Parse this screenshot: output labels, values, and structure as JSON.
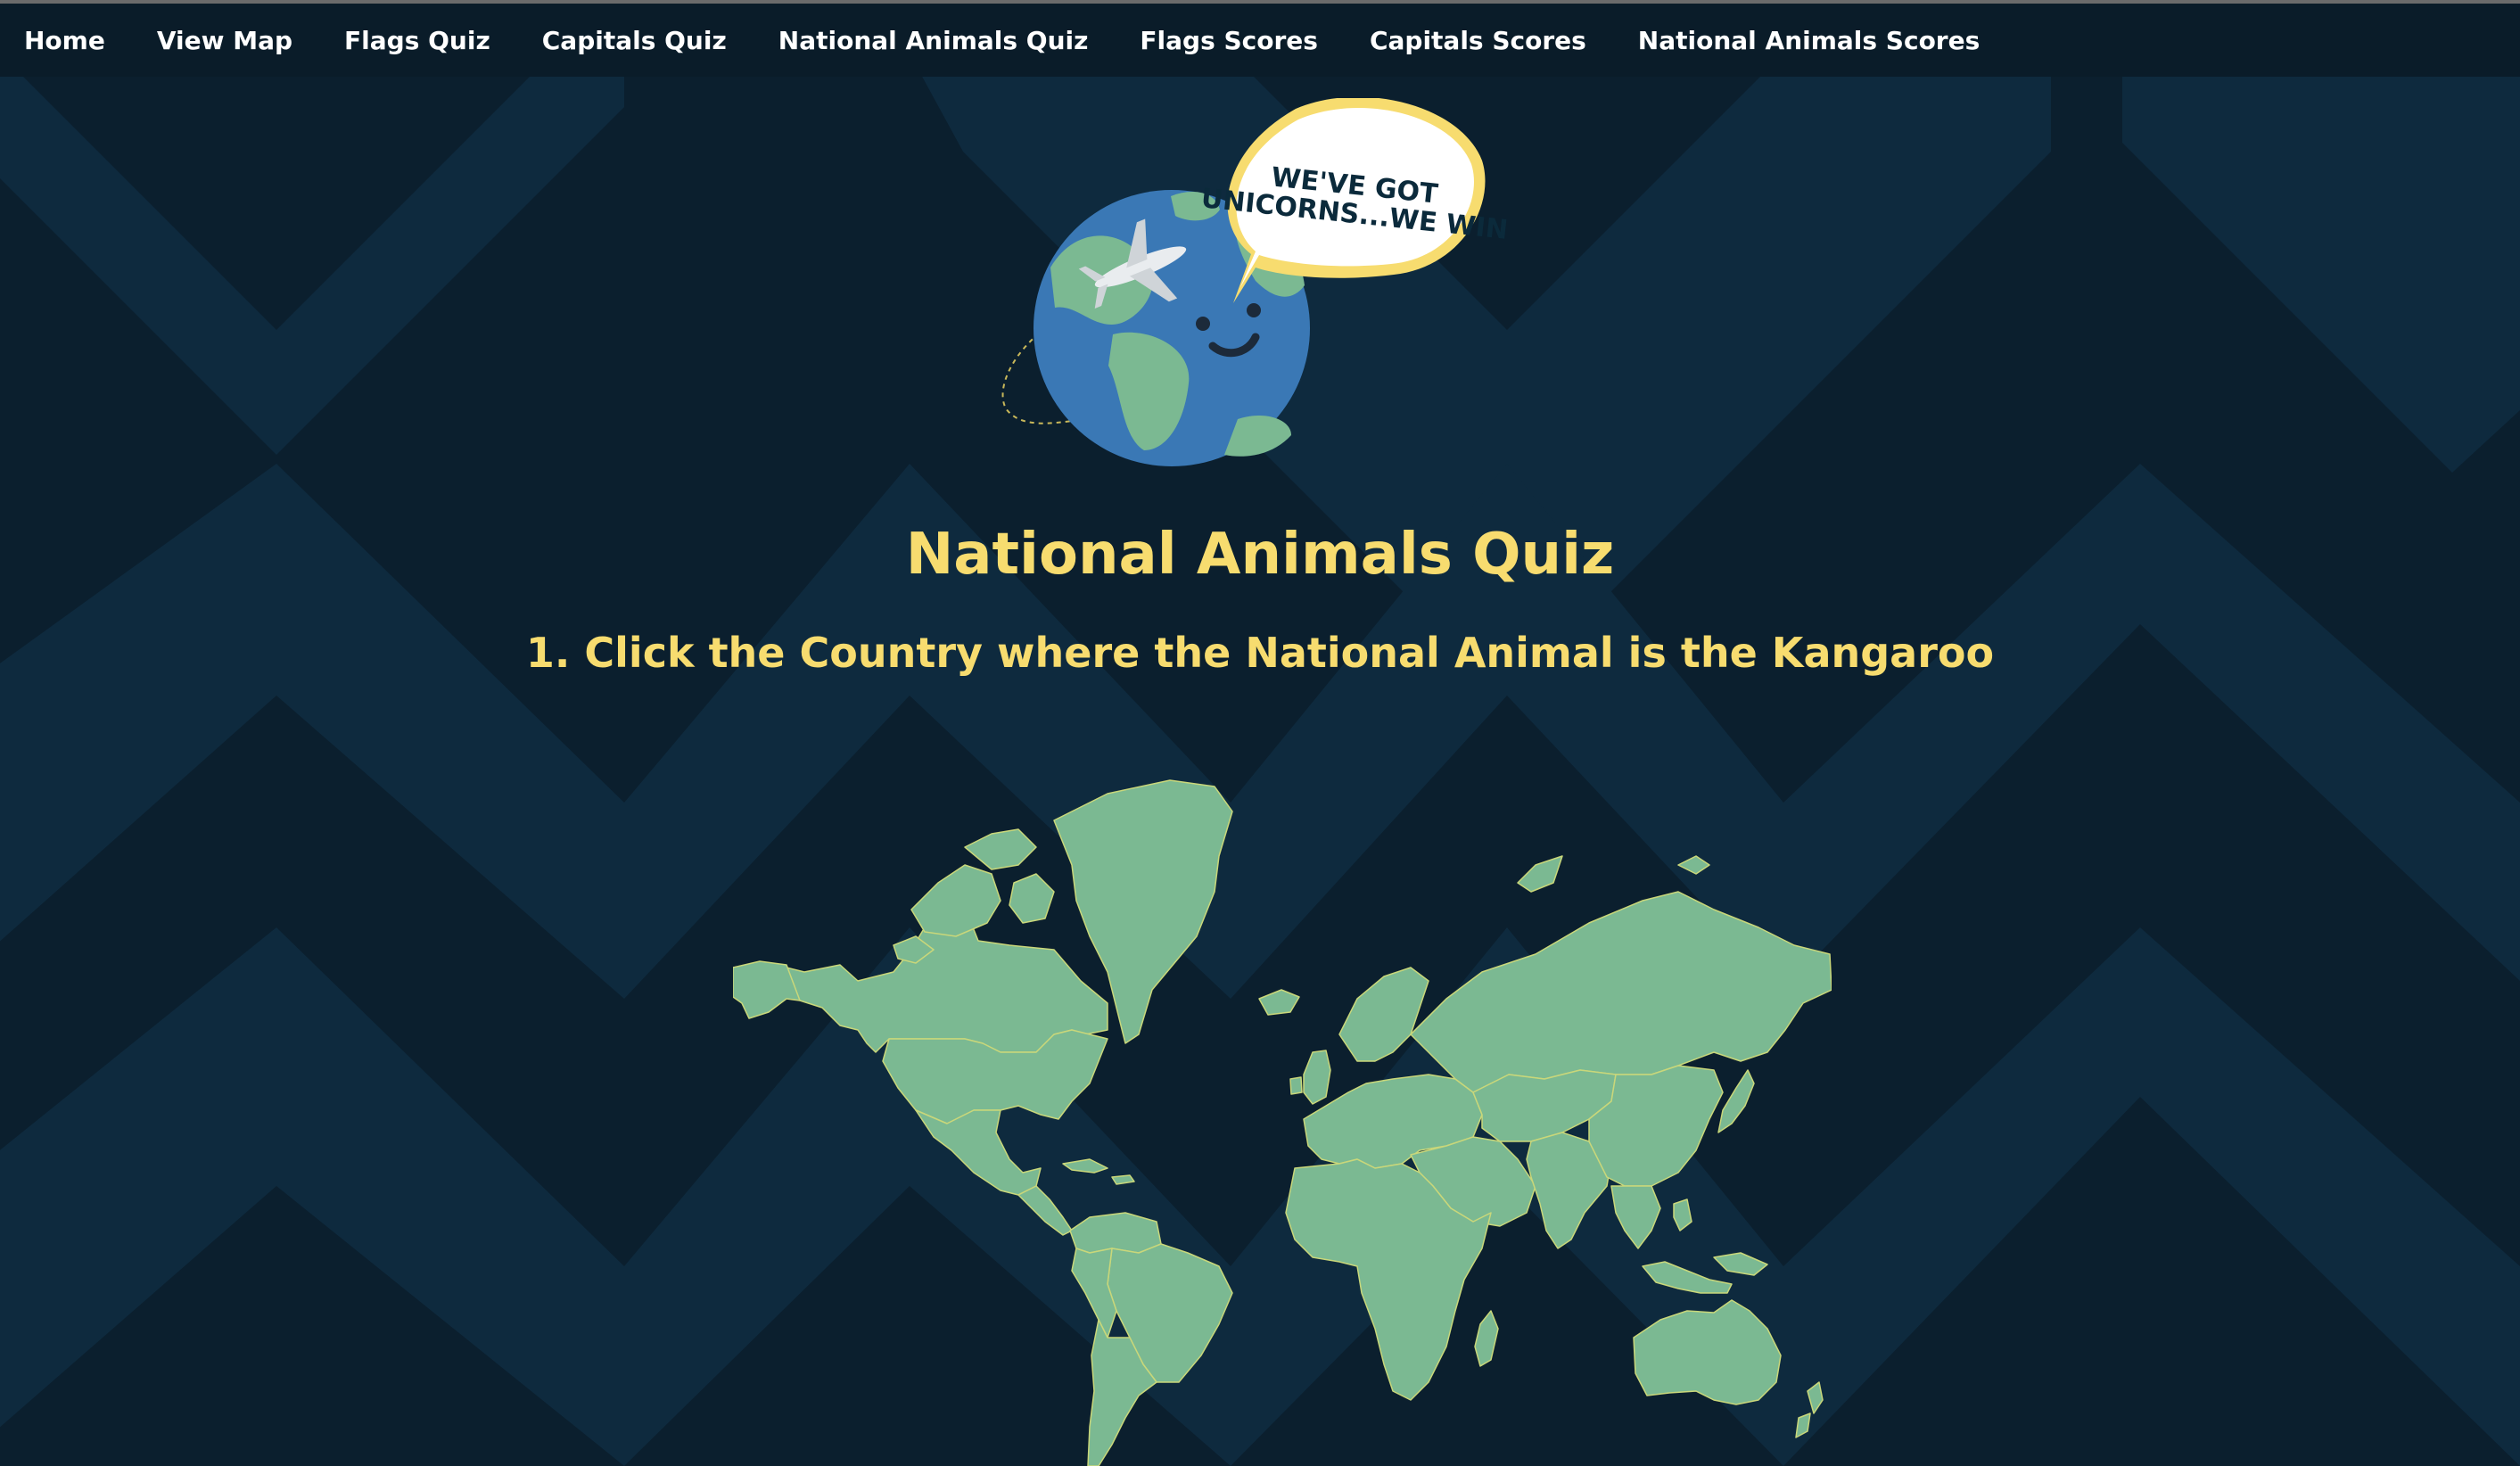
{
  "nav": {
    "items": [
      {
        "label": "Home"
      },
      {
        "label": "View Map"
      },
      {
        "label": "Flags Quiz"
      },
      {
        "label": "Capitals Quiz"
      },
      {
        "label": "National Animals Quiz"
      },
      {
        "label": "Flags Scores"
      },
      {
        "label": "Capitals Scores"
      },
      {
        "label": "National Animals Scores"
      }
    ]
  },
  "logo": {
    "bubble_line1": "WE'VE GOT",
    "bubble_line2": "UNICORNS...WE WIN"
  },
  "quiz": {
    "title": "National Animals Quiz",
    "question": "1. Click the Country where the National Animal is the Kangaroo"
  },
  "colors": {
    "background": "#0b1f2e",
    "chevron": "#0e2a3e",
    "navbar": "#0a1c29",
    "accent_yellow": "#f7dc6f",
    "land": "#7bb992",
    "borders": "#c9d77a",
    "globe_ocean": "#3a78b5"
  }
}
